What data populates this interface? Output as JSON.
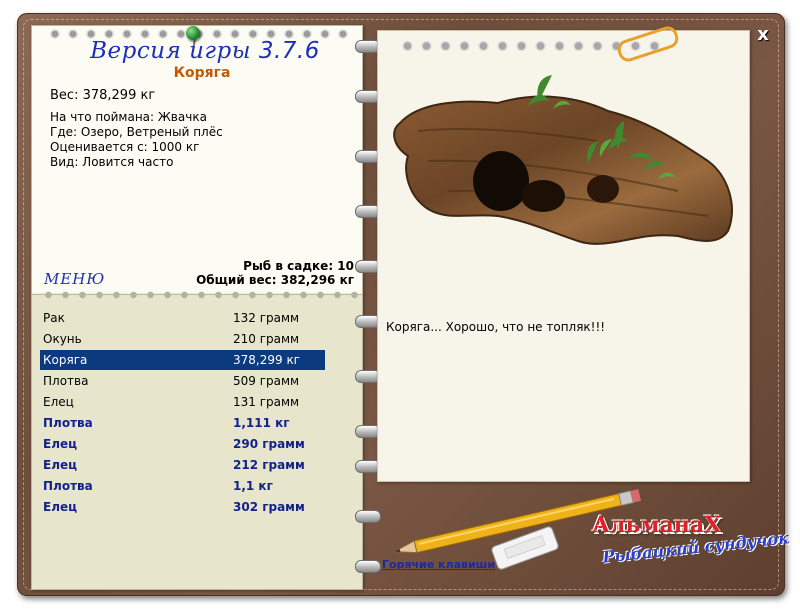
{
  "window": {
    "close_label": "x"
  },
  "header": {
    "title": "Версия игры",
    "version": "3.7.6",
    "item_name": "Коряга"
  },
  "details": {
    "weight": "Вес: 378,299 кг",
    "bait": "На что поймана: Жвачка",
    "place": "Где: Озеро, Ветреный плёс",
    "value": "Оценивается с: 1000 кг",
    "kind": "Вид: Ловится часто"
  },
  "menu_label": "МЕНЮ",
  "cage": {
    "count_text": "Рыб в садке: 10",
    "total_text": "Общий вес: 382,296 кг"
  },
  "catch_list": [
    {
      "name": "Рак",
      "weight": "132 грамм",
      "style": "normal"
    },
    {
      "name": "Окунь",
      "weight": "210 грамм",
      "style": "normal"
    },
    {
      "name": "Коряга",
      "weight": "378,299 кг",
      "style": "selected"
    },
    {
      "name": "Плотва",
      "weight": "509 грамм",
      "style": "normal"
    },
    {
      "name": "Елец",
      "weight": "131 грамм",
      "style": "normal"
    },
    {
      "name": "Плотва",
      "weight": "1,111 кг",
      "style": "bold"
    },
    {
      "name": "Елец",
      "weight": "290 грамм",
      "style": "bold"
    },
    {
      "name": "Елец",
      "weight": "212 грамм",
      "style": "bold"
    },
    {
      "name": "Плотва",
      "weight": "1,1 кг",
      "style": "bold"
    },
    {
      "name": "Елец",
      "weight": "302 грамм",
      "style": "bold"
    }
  ],
  "comment": "Коряга... Хорошо, что не топляк!!!",
  "hotkeys_label": "Горячие клавиши",
  "almanah": {
    "title": "АльманаХ",
    "subtitle": "Рыбацкий сундучок"
  },
  "icons": [
    "pushpin-icon",
    "paperclip-icon",
    "driftwood-image",
    "pencil-icon",
    "eraser-icon",
    "close-icon"
  ]
}
